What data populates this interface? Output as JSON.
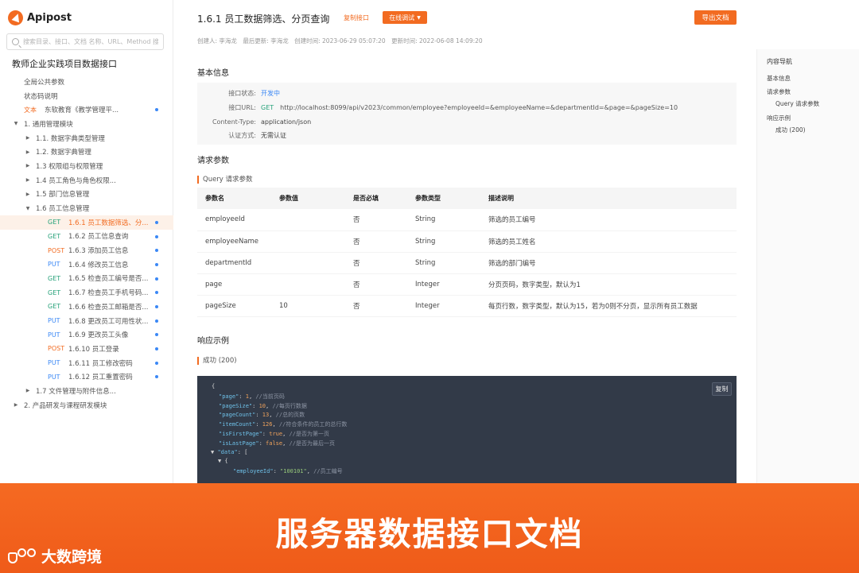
{
  "app": {
    "name": "Apipost"
  },
  "search": {
    "placeholder": "搜索目录、接口、文档 名称、URL、Method 搜索"
  },
  "sidebar": {
    "project_title": "教师企业实践项目数据接口",
    "items": [
      {
        "caret": "",
        "method": "",
        "label": "全局公共参数",
        "indent": 30,
        "dot": false,
        "active": false
      },
      {
        "caret": "",
        "method": "",
        "label": "状态码说明",
        "indent": 30,
        "dot": false,
        "active": false
      },
      {
        "caret": "",
        "method": "文本",
        "label": "东软教育《教学管理平...",
        "indent": 30,
        "dot": true,
        "active": false,
        "method_class": "DOC"
      },
      {
        "caret": "▼",
        "method": "",
        "label": "1. 通用管理模块",
        "indent": 16,
        "dot": false,
        "active": false
      },
      {
        "caret": "▶",
        "method": "",
        "label": "1.1. 数据字典类型管理",
        "indent": 31,
        "dot": false,
        "active": false
      },
      {
        "caret": "▶",
        "method": "",
        "label": "1.2. 数据字典管理",
        "indent": 31,
        "dot": false,
        "active": false
      },
      {
        "caret": "▶",
        "method": "",
        "label": "1.3 权限组与权限管理",
        "indent": 31,
        "dot": false,
        "active": false
      },
      {
        "caret": "▶",
        "method": "",
        "label": "1.4 员工角色与角色权限...",
        "indent": 31,
        "dot": false,
        "active": false
      },
      {
        "caret": "▶",
        "method": "",
        "label": "1.5 部门信息管理",
        "indent": 31,
        "dot": false,
        "active": false
      },
      {
        "caret": "▼",
        "method": "",
        "label": "1.6 员工信息管理",
        "indent": 31,
        "dot": false,
        "active": false
      },
      {
        "caret": "",
        "method": "GET",
        "label": "1.6.1 员工数据筛选、分...",
        "indent": 60,
        "dot": true,
        "active": true
      },
      {
        "caret": "",
        "method": "GET",
        "label": "1.6.2 员工信息查询",
        "indent": 60,
        "dot": true,
        "active": false
      },
      {
        "caret": "",
        "method": "POST",
        "label": "1.6.3 添加员工信息",
        "indent": 60,
        "dot": true,
        "active": false
      },
      {
        "caret": "",
        "method": "PUT",
        "label": "1.6.4 修改员工信息",
        "indent": 60,
        "dot": true,
        "active": false
      },
      {
        "caret": "",
        "method": "GET",
        "label": "1.6.5 检查员工编号是否...",
        "indent": 60,
        "dot": true,
        "active": false
      },
      {
        "caret": "",
        "method": "GET",
        "label": "1.6.7 检查员工手机号码...",
        "indent": 60,
        "dot": true,
        "active": false
      },
      {
        "caret": "",
        "method": "GET",
        "label": "1.6.6 检查员工邮箱是否...",
        "indent": 60,
        "dot": true,
        "active": false
      },
      {
        "caret": "",
        "method": "PUT",
        "label": "1.6.8 更改员工可用性状...",
        "indent": 60,
        "dot": true,
        "active": false
      },
      {
        "caret": "",
        "method": "PUT",
        "label": "1.6.9 更改员工头像",
        "indent": 60,
        "dot": true,
        "active": false
      },
      {
        "caret": "",
        "method": "POST",
        "label": "1.6.10 员工登录",
        "indent": 60,
        "dot": true,
        "active": false
      },
      {
        "caret": "",
        "method": "PUT",
        "label": "1.6.11 员工修改密码",
        "indent": 60,
        "dot": true,
        "active": false
      },
      {
        "caret": "",
        "method": "PUT",
        "label": "1.6.12 员工重置密码",
        "indent": 60,
        "dot": true,
        "active": false
      },
      {
        "caret": "▶",
        "method": "",
        "label": "1.7 文件管理与附件信息...",
        "indent": 31,
        "dot": false,
        "active": false
      },
      {
        "caret": "▶",
        "method": "",
        "label": "2. 产品研发与课程研发模块",
        "indent": 16,
        "dot": false,
        "active": false
      }
    ]
  },
  "doc": {
    "title": "1.6.1 员工数据筛选、分页查询",
    "copy_api_label": "复制接口",
    "debug_label": "在线调试",
    "export_label": "导出文档",
    "meta": {
      "creator": "创建人: 李海龙",
      "updater": "最后更新: 李海龙",
      "created": "创建时间: 2023-06-29 05:07:20",
      "updated": "更新时间: 2022-06-08 14:09:20"
    },
    "basic_info": {
      "heading": "基本信息",
      "status_label": "接口状态:",
      "status_value": "开发中",
      "url_label": "接口URL:",
      "url_method": "GET",
      "url_value": "http://localhost:8099/api/v2023/common/employee?employeeId=&employeeName=&departmentId=&page=&pageSize=10",
      "content_type_label": "Content-Type:",
      "content_type_value": "application/json",
      "auth_label": "认证方式:",
      "auth_value": "无需认证"
    },
    "request": {
      "heading": "请求参数",
      "query_heading": "Query 请求参数",
      "columns": [
        "参数名",
        "参数值",
        "是否必填",
        "参数类型",
        "描述说明"
      ],
      "rows": [
        [
          "employeeId",
          "",
          "否",
          "String",
          "筛选的员工编号"
        ],
        [
          "employeeName",
          "",
          "否",
          "String",
          "筛选的员工姓名"
        ],
        [
          "departmentId",
          "",
          "否",
          "String",
          "筛选的部门编号"
        ],
        [
          "page",
          "",
          "否",
          "Integer",
          "分页页码，数字类型，默认为1"
        ],
        [
          "pageSize",
          "10",
          "否",
          "Integer",
          "每页行数，数字类型，默认为15，若为0则不分页，显示所有员工数据"
        ]
      ]
    },
    "response": {
      "heading": "响应示例",
      "success_heading": "成功 (200)",
      "copy_label": "复制",
      "code": [
        {
          "indent": 0,
          "open": "{"
        },
        {
          "indent": 1,
          "key": "\"page\"",
          "value": "1",
          "vtype": "num",
          "comment": "//当前页码"
        },
        {
          "indent": 1,
          "key": "\"pageSize\"",
          "value": "10",
          "vtype": "num",
          "comment": "//每页行数据"
        },
        {
          "indent": 1,
          "key": "\"pageCount\"",
          "value": "13",
          "vtype": "num",
          "comment": "//总的页数"
        },
        {
          "indent": 1,
          "key": "\"itemCount\"",
          "value": "126",
          "vtype": "num",
          "comment": "//符合条件的员工的总行数"
        },
        {
          "indent": 1,
          "key": "\"isFirstPage\"",
          "value": "true",
          "vtype": "num",
          "comment": "//是否为第一页"
        },
        {
          "indent": 1,
          "key": "\"isLastPage\"",
          "value": "false",
          "vtype": "num",
          "comment": "//是否为最后一页"
        },
        {
          "indent": 1,
          "key": "\"data\"",
          "open": "[",
          "toggle": "▼"
        },
        {
          "indent": 2,
          "open": "{",
          "toggle": "▼"
        },
        {
          "indent": 3,
          "key": "\"employeeId\"",
          "value": "\"100101\"",
          "vtype": "str",
          "comment": "//员工编号"
        }
      ]
    }
  },
  "toc": {
    "title": "内容导航",
    "items": [
      {
        "label": "基本信息",
        "level": 1
      },
      {
        "label": "请求参数",
        "level": 1
      },
      {
        "label": "Query 请求参数",
        "level": 2
      },
      {
        "label": "响应示例",
        "level": 1
      },
      {
        "label": "成功 (200)",
        "level": 2
      }
    ]
  },
  "banner": {
    "caption": "服务器数据接口文档",
    "brand_name": "大数跨境"
  },
  "colors": {
    "accent": "#f26b21",
    "get": "#27a27a",
    "put": "#3b88f5",
    "code_bg": "#323a48"
  }
}
